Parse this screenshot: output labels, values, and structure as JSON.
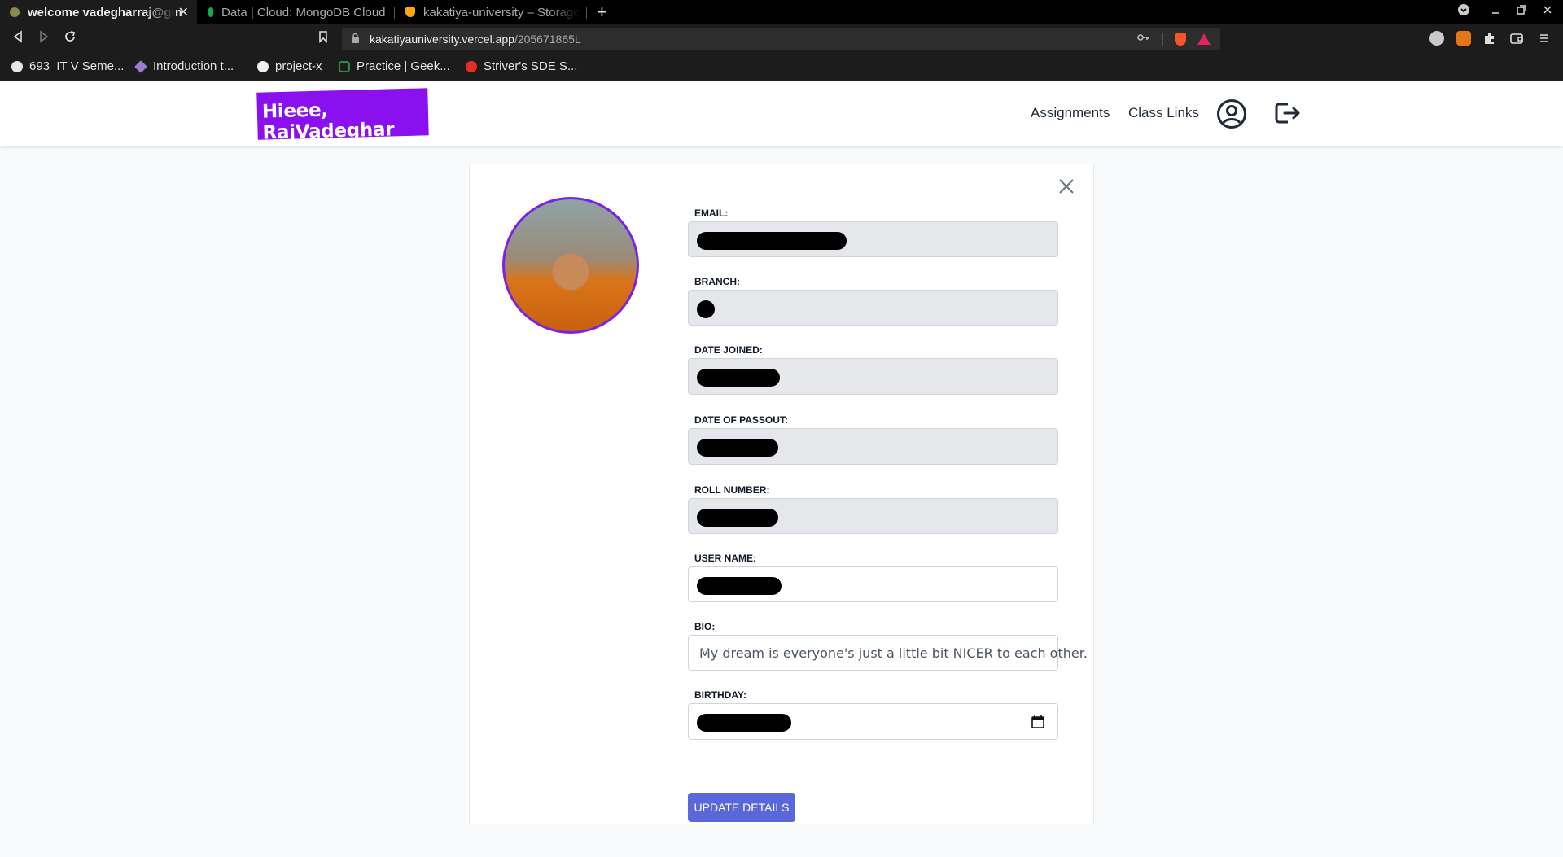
{
  "browser": {
    "tabs": [
      {
        "title": "welcome vadegharraj@gm",
        "active": true
      },
      {
        "title": "Data | Cloud: MongoDB Cloud",
        "active": false
      },
      {
        "title": "kakatiya-university – Storage",
        "active": false
      }
    ],
    "new_tab_symbol": "+",
    "close_tab_symbol": "✕",
    "url_host": "kakatiyauniversity.vercel.app",
    "url_path": "/205671865L",
    "bookmarks": [
      {
        "label": "693_IT V Seme...",
        "icon": "globe-icon"
      },
      {
        "label": "Introduction t...",
        "icon": "ethereum-icon"
      },
      {
        "label": "project-x",
        "icon": "github-icon"
      },
      {
        "label": "Practice | Geek...",
        "icon": "geeksforgeeks-icon"
      },
      {
        "label": "Striver's SDE S...",
        "icon": "youtube-icon"
      }
    ]
  },
  "navbar": {
    "brand": "Hieee, RajVadeghar",
    "links": [
      "Assignments",
      "Class Links"
    ],
    "accent_color": "#8b10f0"
  },
  "profile": {
    "fields": {
      "email": {
        "label": "EMAIL:",
        "value_redacted": true
      },
      "branch": {
        "label": "BRANCH:",
        "value_redacted": true
      },
      "date_joined": {
        "label": "DATE JOINED:",
        "value_redacted": true
      },
      "date_of_passout": {
        "label": "DATE OF PASSOUT:",
        "value_redacted": true
      },
      "roll_number": {
        "label": "ROLL NUMBER:",
        "value_redacted": true
      },
      "user_name": {
        "label": "USER NAME:",
        "value_redacted": true
      },
      "bio": {
        "label": "BIO:",
        "value": "My dream is everyone's just a little bit NICER to each other."
      },
      "birthday": {
        "label": "BIRTHDAY:",
        "value_redacted": true
      }
    },
    "update_button": "UPDATE DETAILS",
    "button_color": "#5a67d8"
  }
}
